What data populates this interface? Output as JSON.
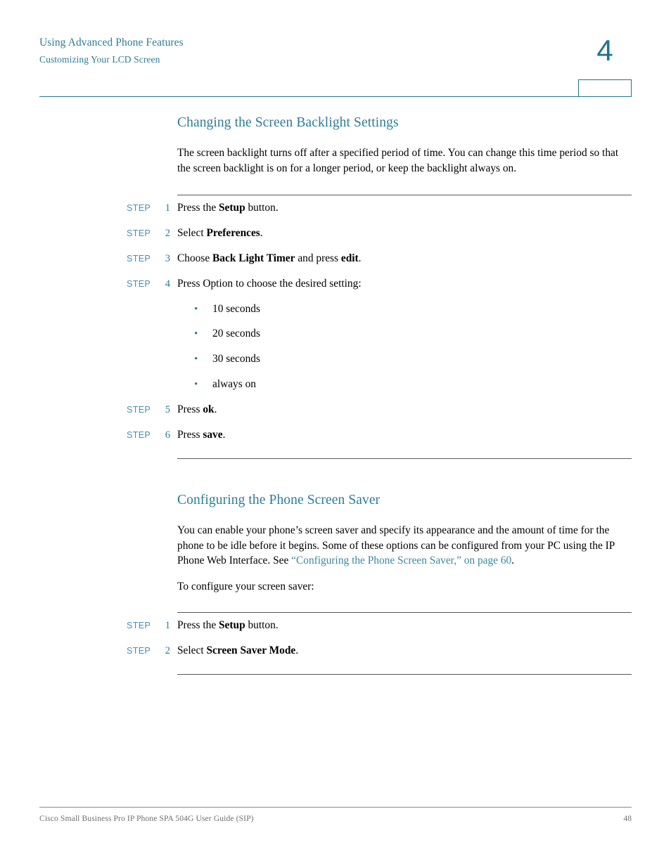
{
  "header": {
    "line1": "Using Advanced Phone Features",
    "line2": "Customizing Your LCD Screen",
    "chapter_number": "4",
    "accent_color": "#20748c"
  },
  "sections": [
    {
      "title": "Changing the Screen Backlight Settings",
      "paragraph": "The screen backlight turns off after a specified period of time. You can change this time period so that the screen backlight is on for a longer period, or keep the backlight always on.",
      "steps": [
        {
          "label": "STEP",
          "number": "1",
          "text_before": "Press the ",
          "bold": "Setup",
          "text_after": " button."
        },
        {
          "label": "STEP",
          "number": "2",
          "text_before": "Select ",
          "bold": "Preferences",
          "text_after": "."
        },
        {
          "label": "STEP",
          "number": "3",
          "text_before": "Choose ",
          "bold": "Back Light Timer",
          "text_mid": " and press ",
          "bold2": "edit",
          "text_after": "."
        },
        {
          "label": "STEP",
          "number": "4",
          "text_before": "Press Option to choose the desired setting:",
          "bold": "",
          "text_after": ""
        },
        {
          "label": "STEP",
          "number": "5",
          "text_before": "Press ",
          "bold": "ok",
          "text_after": "."
        },
        {
          "label": "STEP",
          "number": "6",
          "text_before": "Press ",
          "bold": "save",
          "text_after": "."
        }
      ],
      "bullets": [
        "10 seconds",
        "20 seconds",
        "30 seconds",
        "always on"
      ]
    },
    {
      "title": "Configuring the Phone Screen Saver",
      "paragraph_part1": "You can enable your phone’s screen saver and specify its appearance and the amount of time for the phone to be idle before it begins. Some of these options can be configured from your PC using the IP Phone Web Interface. See ",
      "paragraph_link": "“Configuring the Phone Screen Saver,” on page 60",
      "paragraph_part2": ".",
      "paragraph2": "To configure your screen saver:",
      "steps": [
        {
          "label": "STEP",
          "number": "1",
          "text_before": "Press the ",
          "bold": "Setup",
          "text_after": " button."
        },
        {
          "label": "STEP",
          "number": "2",
          "text_before": "Select ",
          "bold": "Screen Saver Mode",
          "text_after": "."
        }
      ]
    }
  ],
  "footer": {
    "text": "Cisco Small Business Pro IP Phone SPA 504G User Guide (SIP)",
    "page_number": "48"
  },
  "bullet_glyph": "•"
}
